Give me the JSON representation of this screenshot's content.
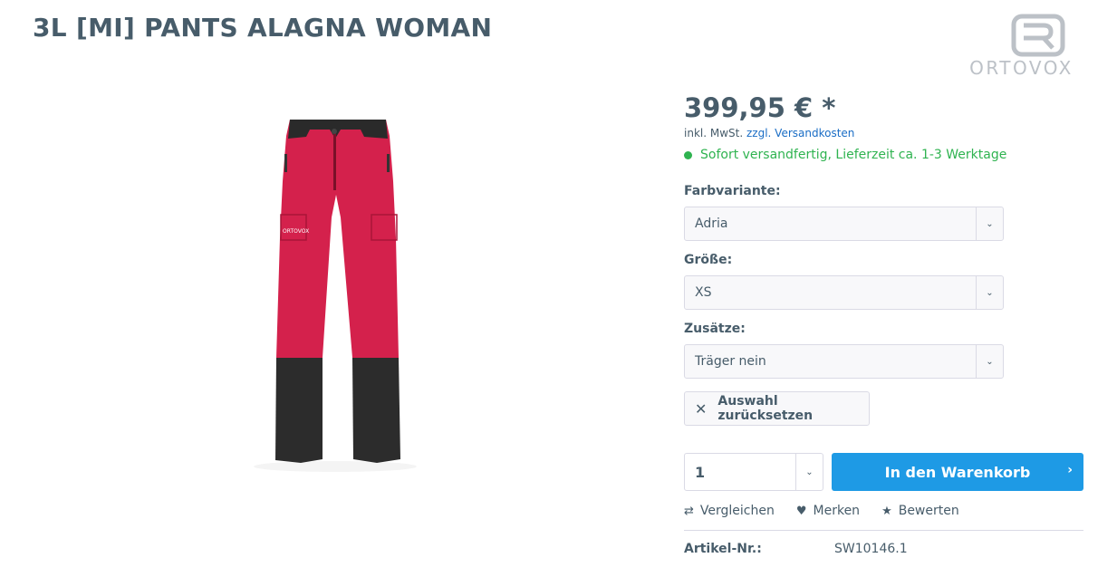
{
  "product": {
    "title": "3L [MI] PANTS ALAGNA WOMAN",
    "image_alt": "pants-product-image"
  },
  "brand": {
    "logo_text": "ORTOVOX",
    "logo_color": "#bcc1c7"
  },
  "pricing": {
    "price": "399,95 € *",
    "tax_prefix": "inkl. MwSt. ",
    "shipping_link": "zzgl. Versandkosten",
    "delivery": "Sofort versandfertig, Lieferzeit ca. 1-3 Werktage",
    "delivery_color": "#2fb350"
  },
  "options": {
    "color_label": "Farbvariante:",
    "color_value": "Adria",
    "size_label": "Größe:",
    "size_value": "XS",
    "extras_label": "Zusätze:",
    "extras_value": "Träger nein",
    "reset_label": "Auswahl zurücksetzen"
  },
  "purchase": {
    "quantity": "1",
    "cart_label": "In den Warenkorb",
    "cart_color": "#1e9ae5"
  },
  "actions": {
    "compare": "Vergleichen",
    "remember": "Merken",
    "rate": "Bewerten"
  },
  "details": {
    "article_label": "Artikel-Nr.:",
    "article_value": "SW10146.1"
  }
}
